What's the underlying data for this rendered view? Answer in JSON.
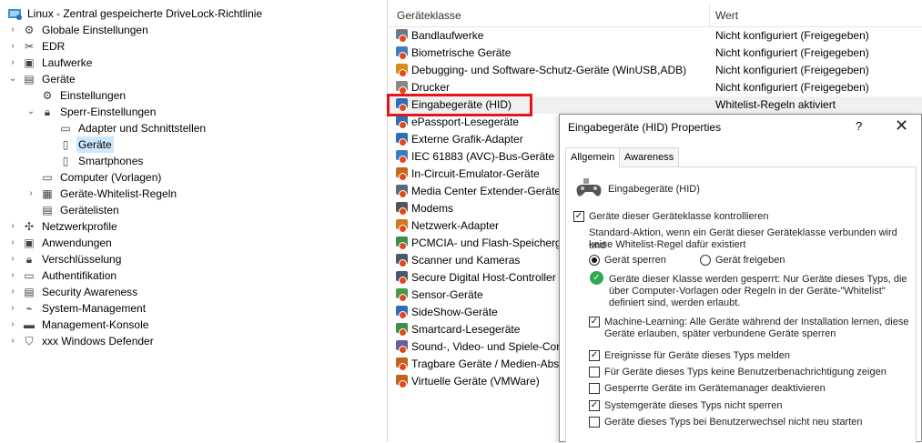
{
  "tree": {
    "root_label": "Linux - Zentral gespeicherte DriveLock-Richtlinie",
    "items": [
      {
        "label": "Globale Einstellungen"
      },
      {
        "label": "EDR"
      },
      {
        "label": "Laufwerke"
      },
      {
        "label": "Geräte"
      },
      {
        "label": "Einstellungen"
      },
      {
        "label": "Sperr-Einstellungen"
      },
      {
        "label": "Adapter und Schnittstellen"
      },
      {
        "label": "Geräte"
      },
      {
        "label": "Smartphones"
      },
      {
        "label": "Computer (Vorlagen)"
      },
      {
        "label": "Geräte-Whitelist-Regeln"
      },
      {
        "label": "Gerätelisten"
      },
      {
        "label": "Netzwerkprofile"
      },
      {
        "label": "Anwendungen"
      },
      {
        "label": "Verschlüsselung"
      },
      {
        "label": "Authentifikation"
      },
      {
        "label": "Security Awareness"
      },
      {
        "label": "System-Management"
      },
      {
        "label": "Management-Konsole"
      },
      {
        "label": "xxx Windows Defender"
      }
    ]
  },
  "list": {
    "col_class": "Geräteklasse",
    "col_value": "Wert",
    "rows": [
      {
        "name": "Bandlaufwerke",
        "value": "Nicht konfiguriert (Freigegeben)"
      },
      {
        "name": "Biometrische Geräte",
        "value": "Nicht konfiguriert (Freigegeben)"
      },
      {
        "name": "Debugging- und Software-Schutz-Geräte (WinUSB,ADB)",
        "value": "Nicht konfiguriert (Freigegeben)"
      },
      {
        "name": "Drucker",
        "value": "Nicht konfiguriert (Freigegeben)"
      },
      {
        "name": "Eingabegeräte (HID)",
        "value": "Whitelist-Regeln aktiviert"
      },
      {
        "name": "ePassport-Lesegeräte",
        "value": ""
      },
      {
        "name": "Externe Grafik-Adapter",
        "value": ""
      },
      {
        "name": "IEC 61883 (AVC)-Bus-Geräte",
        "value": ""
      },
      {
        "name": "In-Circuit-Emulator-Geräte",
        "value": ""
      },
      {
        "name": "Media Center Extender-Geräte",
        "value": ""
      },
      {
        "name": "Modems",
        "value": ""
      },
      {
        "name": "Netzwerk-Adapter",
        "value": ""
      },
      {
        "name": "PCMCIA- und Flash-Speichergeräte",
        "value": ""
      },
      {
        "name": "Scanner und Kameras",
        "value": ""
      },
      {
        "name": "Secure Digital Host-Controller",
        "value": ""
      },
      {
        "name": "Sensor-Geräte",
        "value": ""
      },
      {
        "name": "SideShow-Geräte",
        "value": ""
      },
      {
        "name": "Smartcard-Lesegeräte",
        "value": ""
      },
      {
        "name": "Sound-, Video- und Spiele-Controller",
        "value": ""
      },
      {
        "name": "Tragbare Geräte / Medien-Abspielgeräte",
        "value": ""
      },
      {
        "name": "Virtuelle Geräte (VMWare)",
        "value": ""
      }
    ]
  },
  "dialog": {
    "title": "Eingabegeräte (HID) Properties",
    "help": "?",
    "close": "✕",
    "tabs": [
      {
        "label": "Allgemein"
      },
      {
        "label": "Awareness"
      }
    ],
    "device_name": "Eingabegeräte (HID)",
    "control_class_label": "Geräte dieser Geräteklasse kontrollieren",
    "default_action_text_1": "Standard-Aktion, wenn ein Gerät dieser Geräteklasse verbunden wird und",
    "default_action_text_2": "keine Whitelist-Regel dafür existiert",
    "radio_lock": "Gerät sperren",
    "radio_allow": "Gerät freigeben",
    "info_1": "Geräte dieser Klasse werden gesperrt: Nur Geräte dieses Typs, die",
    "info_2": "über Computer-Vorlagen oder Regeln in der Geräte-\"Whitelist\"",
    "info_3": "definiert sind, werden erlaubt.",
    "ml_1": "Machine-Learning: Alle Geräte während der Installation lernen, diese",
    "ml_2": "Geräte erlauben, später verbundene Geräte sperren",
    "opt_events": "Ereignisse für Geräte dieses Typs melden",
    "opt_no_notify": "Für Geräte dieses Typs keine Benutzerbenachrichtigung zeigen",
    "opt_disable_mgr": "Gesperrte Geräte im Gerätemanager deaktivieren",
    "opt_system": "Systemgeräte dieses Typs nicht sperren",
    "opt_user_switch": "Geräte dieses Typs bei Benutzerwechsel nicht neu starten",
    "states": {
      "control_class": true,
      "radio_lock": true,
      "machine_learning": true,
      "events": true,
      "no_notify": false,
      "disable_mgr": false,
      "system": true,
      "user_switch": false
    }
  },
  "colors": {
    "selection": "#cce8ff",
    "highlight_border": "#e3161e",
    "badge": "#e04a1a",
    "ok_green": "#2fa84f"
  }
}
